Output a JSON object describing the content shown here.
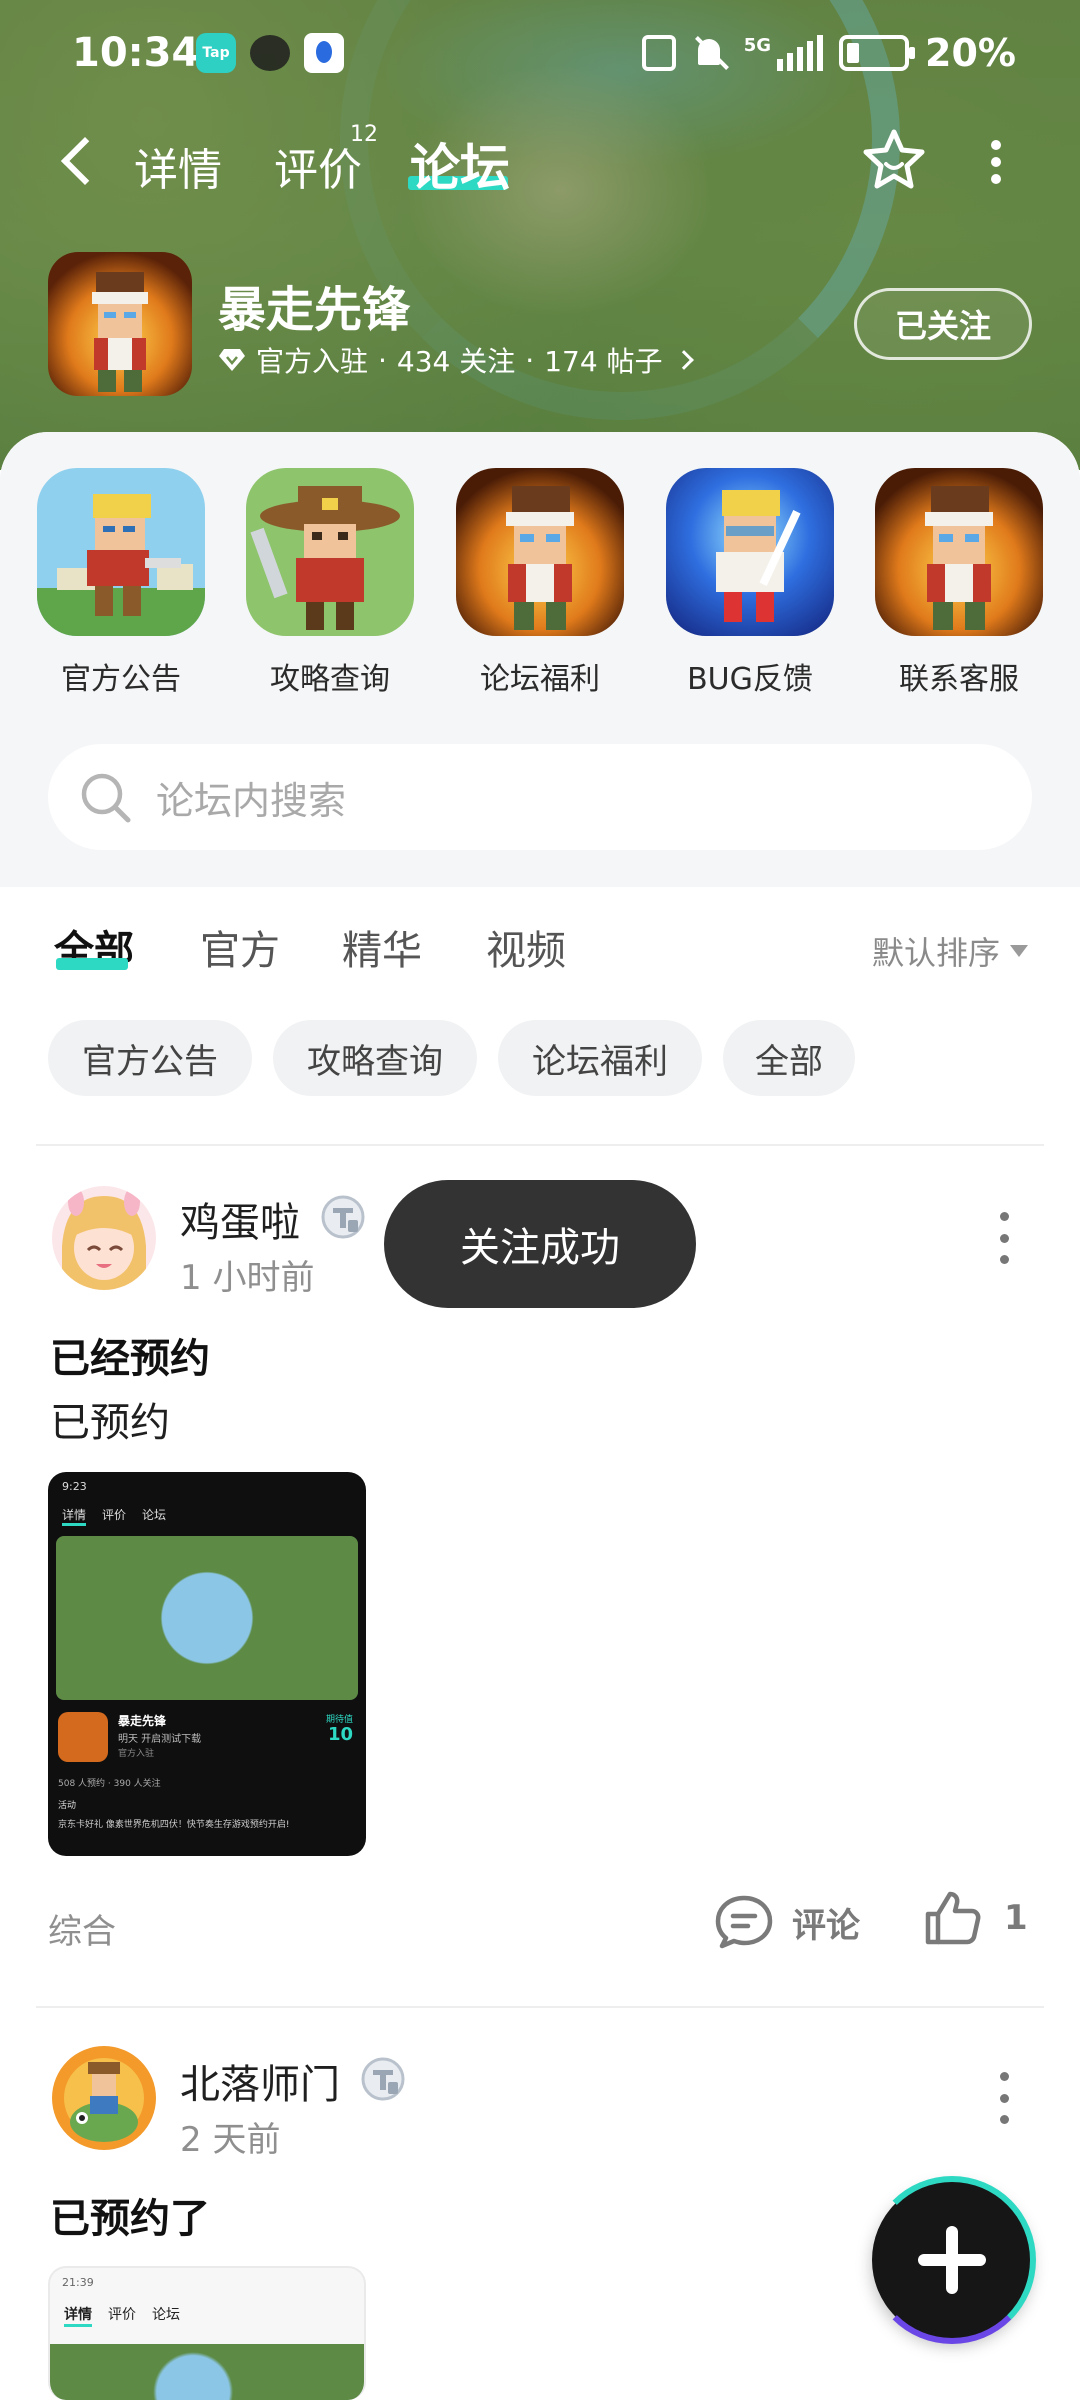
{
  "status_bar": {
    "time": "10:34",
    "tap_label": "Tap",
    "network": "5G",
    "battery": "20%",
    "battery_level": 0.2
  },
  "nav": {
    "tabs": [
      {
        "label": "详情"
      },
      {
        "label": "评价",
        "badge": "12"
      },
      {
        "label": "论坛"
      }
    ],
    "active_tab": "论坛"
  },
  "game": {
    "title": "暴走先锋",
    "official": "官方入驻",
    "follows": "434 关注",
    "posts": "174 帖子",
    "separator": "·",
    "follow_button": "已关注"
  },
  "shortcuts": [
    {
      "label": "官方公告",
      "icon": "hero-gun-icon"
    },
    {
      "label": "攻略查询",
      "icon": "cowboy-icon"
    },
    {
      "label": "论坛福利",
      "icon": "hero-headband-icon"
    },
    {
      "label": "BUG反馈",
      "icon": "hero-blue-icon"
    },
    {
      "label": "联系客服",
      "icon": "hero-headband-icon"
    }
  ],
  "search": {
    "placeholder": "论坛内搜索"
  },
  "filter_tabs": [
    {
      "label": "全部"
    },
    {
      "label": "官方"
    },
    {
      "label": "精华"
    },
    {
      "label": "视频"
    }
  ],
  "sort": {
    "label": "默认排序"
  },
  "chips": [
    {
      "label": "官方公告"
    },
    {
      "label": "攻略查询"
    },
    {
      "label": "论坛福利"
    },
    {
      "label": "全部"
    }
  ],
  "posts": [
    {
      "username": "鸡蛋啦",
      "time": "1 小时前",
      "title": "已经预约",
      "body": "已预约",
      "tag": "综合",
      "comment_label": "评论",
      "likes": "1",
      "screenshot": {
        "time": "9:23",
        "tabs": [
          "详情",
          "评价",
          "论坛"
        ],
        "game_title": "暴走先锋",
        "subtitle": "明天 开启测试下载",
        "official": "官方入驻",
        "score_label": "期待值",
        "score": "10",
        "stats": "508 人预约 · 390 人关注",
        "activity": "活动",
        "promo": "京东卡好礼 像素世界危机四伏！快节奏生存游戏预约开启!"
      }
    },
    {
      "username": "北落师门",
      "time": "2 天前",
      "title": "已预约了",
      "screenshot": {
        "time": "21:39",
        "tabs": [
          "详情",
          "评价",
          "论坛"
        ]
      }
    }
  ],
  "toast": {
    "text": "关注成功"
  },
  "colors": {
    "accent": "#2ed9c3",
    "toast_bg": "#333333",
    "banner": "#6b8f4c"
  }
}
